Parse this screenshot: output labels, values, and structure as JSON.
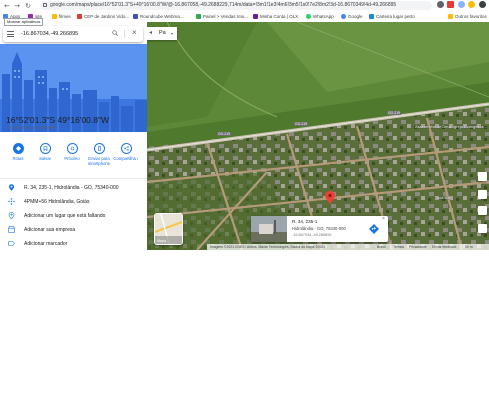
{
  "browser": {
    "url": "google.com/maps/place/16°52'01.3\"S+49°16'00.8\"W/@-16.867058,-49.2688229,714m/data=!3m1!1e3!4m6!3m5!1s0!7e2!8m2!3d-16.8670349!4d-49.266895",
    "tooltip": "Mostrar aplicativos",
    "bookmarks": [
      {
        "label": "Apps",
        "color": "#4285f4"
      },
      {
        "label": "site",
        "color": "#9c27b0"
      },
      {
        "label": "filmes",
        "color": "#fbbc04"
      },
      {
        "label": "CEP de Jardins Vido...",
        "color": "#e53935"
      },
      {
        "label": "Roundcube Webma...",
        "color": "#3f51b5"
      },
      {
        "label": "Painel > Vendas Ims...",
        "color": "#34a853"
      },
      {
        "label": "Minha Conta | OLX",
        "color": "#6a1b9a"
      },
      {
        "label": "WhatsApp",
        "color": "#25d366"
      },
      {
        "label": "Google",
        "color": "#4285f4"
      },
      {
        "label": "Carteira lugar perto",
        "color": "#1e88e5"
      },
      {
        "label": "Outros favoritos",
        "color": "#fbbc04"
      }
    ]
  },
  "search": {
    "value": "-16.867034,-49.266895"
  },
  "place": {
    "coords_dms": "16°52'01.3\"S 49°16'00.8\"W",
    "coords_dec": "-16.867034,-49.266895"
  },
  "actions": [
    {
      "label": "Rotas",
      "icon": "directions-icon"
    },
    {
      "label": "Salvar",
      "icon": "bookmark-icon"
    },
    {
      "label": "Próximo",
      "icon": "nearby-icon"
    },
    {
      "label": "Enviar para smartphone",
      "icon": "phone-icon"
    },
    {
      "label": "Compartilha r",
      "icon": "share-icon"
    }
  ],
  "info_rows": [
    {
      "text": "R. 34, 235-1, Hidrolândia - GO, 75340-000",
      "icon": "pin-icon"
    },
    {
      "text": "4PMM+56 Hidrolândia, Goiás",
      "icon": "pluscode-icon"
    },
    {
      "text": "Adicionar um lugar que está faltando",
      "icon": "add-place-icon"
    },
    {
      "text": "Adicionar sua empresa",
      "icon": "business-icon"
    },
    {
      "text": "Adicionar marcador",
      "icon": "label-icon"
    }
  ],
  "map": {
    "category_button": "Pa",
    "thumb_label": "Mapa",
    "road_labels": [
      "GO-219",
      "GO-219",
      "GO-219"
    ],
    "place_label": "Assembléia de Deus Igreja Evangélica...",
    "place_label_2": "Toca Bar",
    "card": {
      "title": "R. 34, 235-1",
      "address": "Hidrolândia - GO, 75340-000",
      "coords": "-16.867034,-49.266895"
    },
    "footer": [
      "Imagens ©2021 CNES / Airbus, Maxar Technologies, Dados do mapa ©2021",
      "Brasil",
      "Termos",
      "Privacidade",
      "Enviar feedback",
      "50 m"
    ]
  }
}
